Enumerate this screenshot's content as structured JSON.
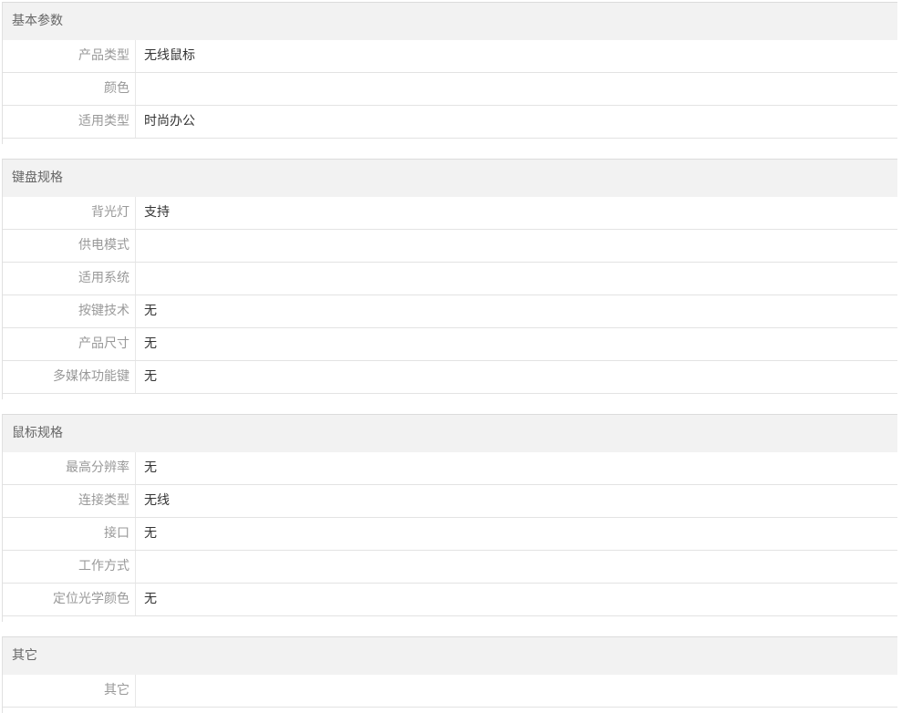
{
  "sections": [
    {
      "title": "基本参数",
      "rows": [
        {
          "label": "产品类型",
          "value": "无线鼠标"
        },
        {
          "label": "颜色",
          "value": ""
        },
        {
          "label": "适用类型",
          "value": "时尚办公"
        }
      ]
    },
    {
      "title": "键盘规格",
      "rows": [
        {
          "label": "背光灯",
          "value": "支持"
        },
        {
          "label": "供电模式",
          "value": ""
        },
        {
          "label": "适用系统",
          "value": ""
        },
        {
          "label": "按键技术",
          "value": "无"
        },
        {
          "label": "产品尺寸",
          "value": "无"
        },
        {
          "label": "多媒体功能键",
          "value": "无"
        }
      ]
    },
    {
      "title": "鼠标规格",
      "rows": [
        {
          "label": "最高分辨率",
          "value": "无"
        },
        {
          "label": "连接类型",
          "value": "无线"
        },
        {
          "label": "接口",
          "value": "无"
        },
        {
          "label": "工作方式",
          "value": ""
        },
        {
          "label": "定位光学颜色",
          "value": "无"
        }
      ]
    },
    {
      "title": "其它",
      "rows": [
        {
          "label": "其它",
          "value": ""
        }
      ]
    }
  ]
}
